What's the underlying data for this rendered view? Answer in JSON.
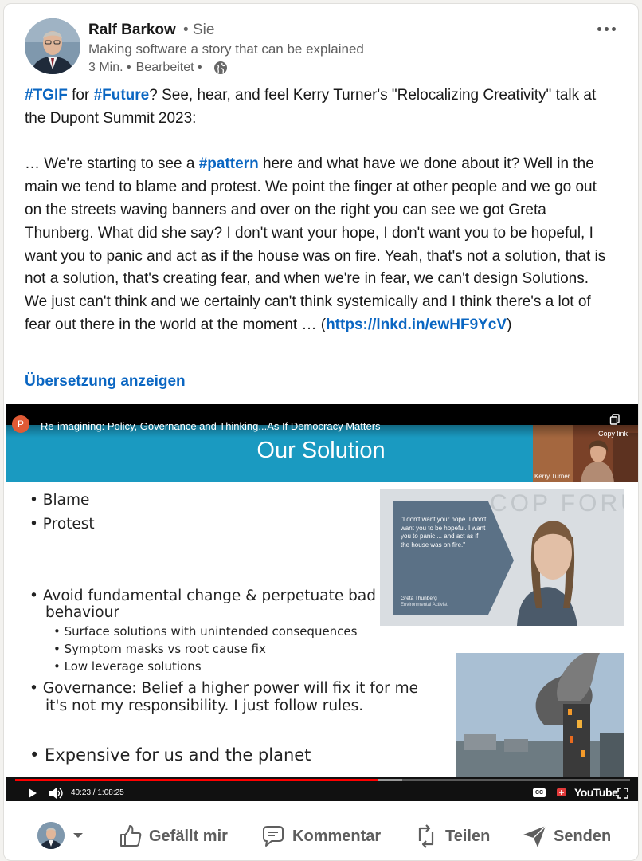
{
  "post": {
    "author": {
      "name": "Ralf Barkow",
      "degree": "• Sie",
      "headline": "Making software a story that can be explained",
      "time": "3 Min. •",
      "edited": "Bearbeitet •"
    },
    "body": {
      "p1": [
        {
          "t": "#TGIF",
          "k": "tag"
        },
        {
          "t": " for "
        },
        {
          "t": "#Future",
          "k": "tag"
        },
        {
          "t": "? See, hear, and feel Kerry Turner's \"Relocalizing Creativity\" talk at the Dupont Summit 2023:"
        }
      ],
      "p2": [
        {
          "t": "… We're starting to see a "
        },
        {
          "t": "#pattern",
          "k": "tag"
        },
        {
          "t": " here and what have we done about it? Well in the main we tend to blame and protest. We point the finger at other people and we go out on the streets waving banners and over on the right you can see we got Greta Thunberg. What did she say? I don't want your hope, I don't want you to be hopeful, I want you to panic and act as if the house was on fire. Yeah, that's not a solution, that is not a solution, that's creating fear, and when we're in fear, we can't design Solutions. We just can't think and we certainly can't think systemically and I think there's a lot of fear out there in the world at the moment … ("
        },
        {
          "t": "https://lnkd.in/ewHF9YcV",
          "k": "link"
        },
        {
          "t": ")"
        }
      ]
    },
    "translate_label": "Übersetzung anzeigen"
  },
  "video": {
    "channel_initial": "P",
    "title": "Re-imagining: Policy, Governance and Thinking...As If Democracy Matters",
    "copy_link_label": "Copy link",
    "time": "40:23 / 1:08:25",
    "progress_percent": 59,
    "cc_label": "CC",
    "youtube_label": "YouTube",
    "slide": {
      "title": "Our Solution",
      "speaker_name": "Kerry Turner",
      "bullets": [
        "• Blame",
        "• Protest",
        "• Avoid fundamental change & perpetuate bad",
        "behaviour",
        "• Governance: Belief a higher power will fix it for me",
        "it's not my responsibility. I just follow rules.",
        "• Expensive for us and the planet"
      ],
      "sub_bullets": [
        "• Surface solutions with unintended consequences",
        "• Symptom masks vs root cause fix",
        "• Low leverage solutions"
      ],
      "quote": {
        "text": "\"I don't want your hope. I don't want you to be hopeful. I want you to panic ... and act as if the house was on fire.\"",
        "name": "Greta Thunberg",
        "role": "Environmental Activist"
      },
      "backdrop_text": "COP FORUM"
    }
  },
  "actions": {
    "like": "Gefällt mir",
    "comment": "Kommentar",
    "share": "Teilen",
    "send": "Senden"
  }
}
